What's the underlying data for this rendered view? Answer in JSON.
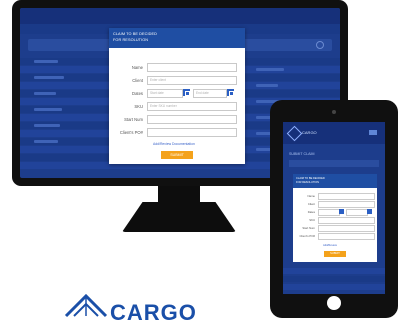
{
  "modal": {
    "title_line1": "CLAIM TO BE DECIDED",
    "title_line2": "FOR RESOLUTION",
    "fields": [
      {
        "label": "Name",
        "placeholder": ""
      },
      {
        "label": "Client",
        "placeholder": "Enter client"
      },
      {
        "label": "Dates",
        "placeholder": "Start date",
        "placeholder2": "End date"
      },
      {
        "label": "SKU",
        "placeholder": "Enter SKU number"
      },
      {
        "label": "Start Num",
        "placeholder": ""
      },
      {
        "label": "Client's PO#",
        "placeholder": ""
      }
    ],
    "link": "Add/Review Documentation",
    "submit": "SUBMIT"
  },
  "tablet": {
    "brand": "CARGO",
    "header_tab": "SUBMIT CLAIM",
    "title_line1": "CLAIM TO BE DECIDED",
    "title_line2": "FOR RESOLUTION",
    "fields": [
      "Name",
      "Client",
      "Dates",
      "SKU",
      "Start Num",
      "Client's PO#"
    ],
    "link": "Add/Review",
    "submit": "SUBMIT"
  },
  "logo": {
    "text": "CARGO"
  },
  "colors": {
    "primary": "#1f4ea3",
    "accent": "#f4a21b",
    "bg_dark": "#1d3d8c"
  }
}
